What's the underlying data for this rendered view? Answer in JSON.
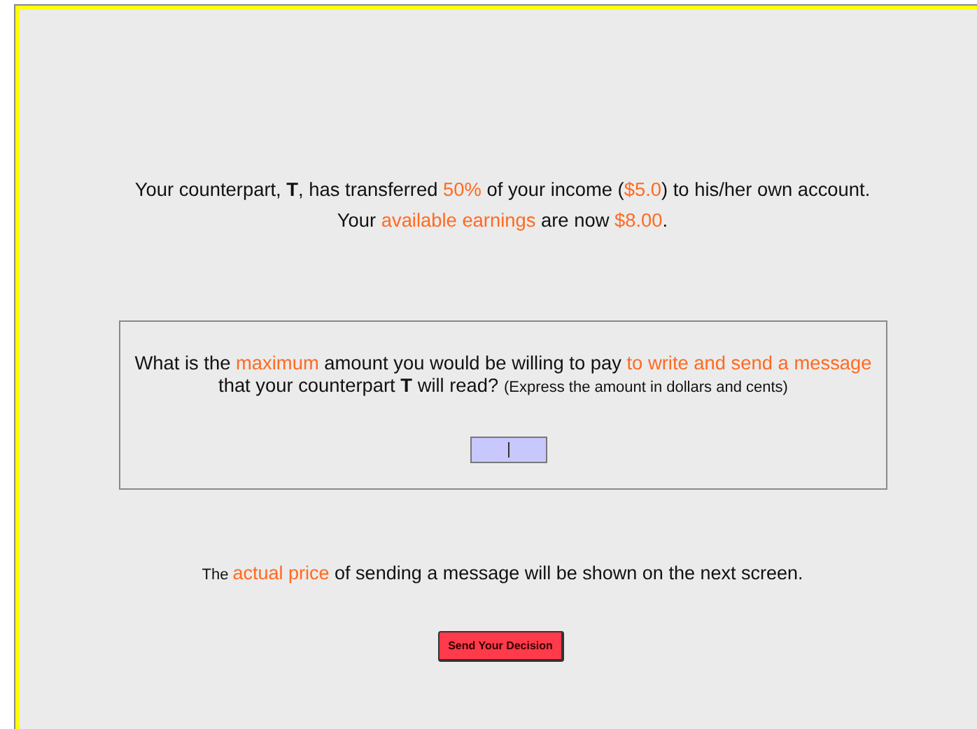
{
  "status_lines": [
    [
      {
        "text": "Your counterpart, **T**, has transferred ",
        "kind": "normal"
      },
      {
        "text": "50%",
        "kind": "highlight"
      },
      {
        "text": " of your income (",
        "kind": "normal"
      },
      {
        "text": "$5.0",
        "kind": "highlight"
      },
      {
        "text": ") to his/her own account.",
        "kind": "normal"
      }
    ],
    [
      {
        "text": "Your ",
        "kind": "normal"
      },
      {
        "text": "available earnings",
        "kind": "highlight"
      },
      {
        "text": " are now ",
        "kind": "normal"
      },
      {
        "text": "$8.00",
        "kind": "highlight"
      },
      {
        "text": ".",
        "kind": "normal"
      }
    ]
  ],
  "question": [
    {
      "text": "What is the ",
      "kind": "normal"
    },
    {
      "text": "maximum",
      "kind": "highlight"
    },
    {
      "text": " amount you would be willing to pay ",
      "kind": "normal"
    },
    {
      "text": "to write and send a message",
      "kind": "highlight"
    },
    {
      "text": " that your counterpart **T** will read? ",
      "kind": "normal"
    },
    {
      "text": "(Express the amount in dollars and cents)",
      "kind": "small"
    }
  ],
  "amount_field": {
    "focused": true
  },
  "note": [
    {
      "text": "The ",
      "kind": "small"
    },
    {
      "text": "actual price",
      "kind": "highlight"
    },
    {
      "text": " of sending a message will be shown on the next screen.",
      "kind": "normal"
    }
  ],
  "submit_button": {
    "label": "Send Your Decision"
  }
}
